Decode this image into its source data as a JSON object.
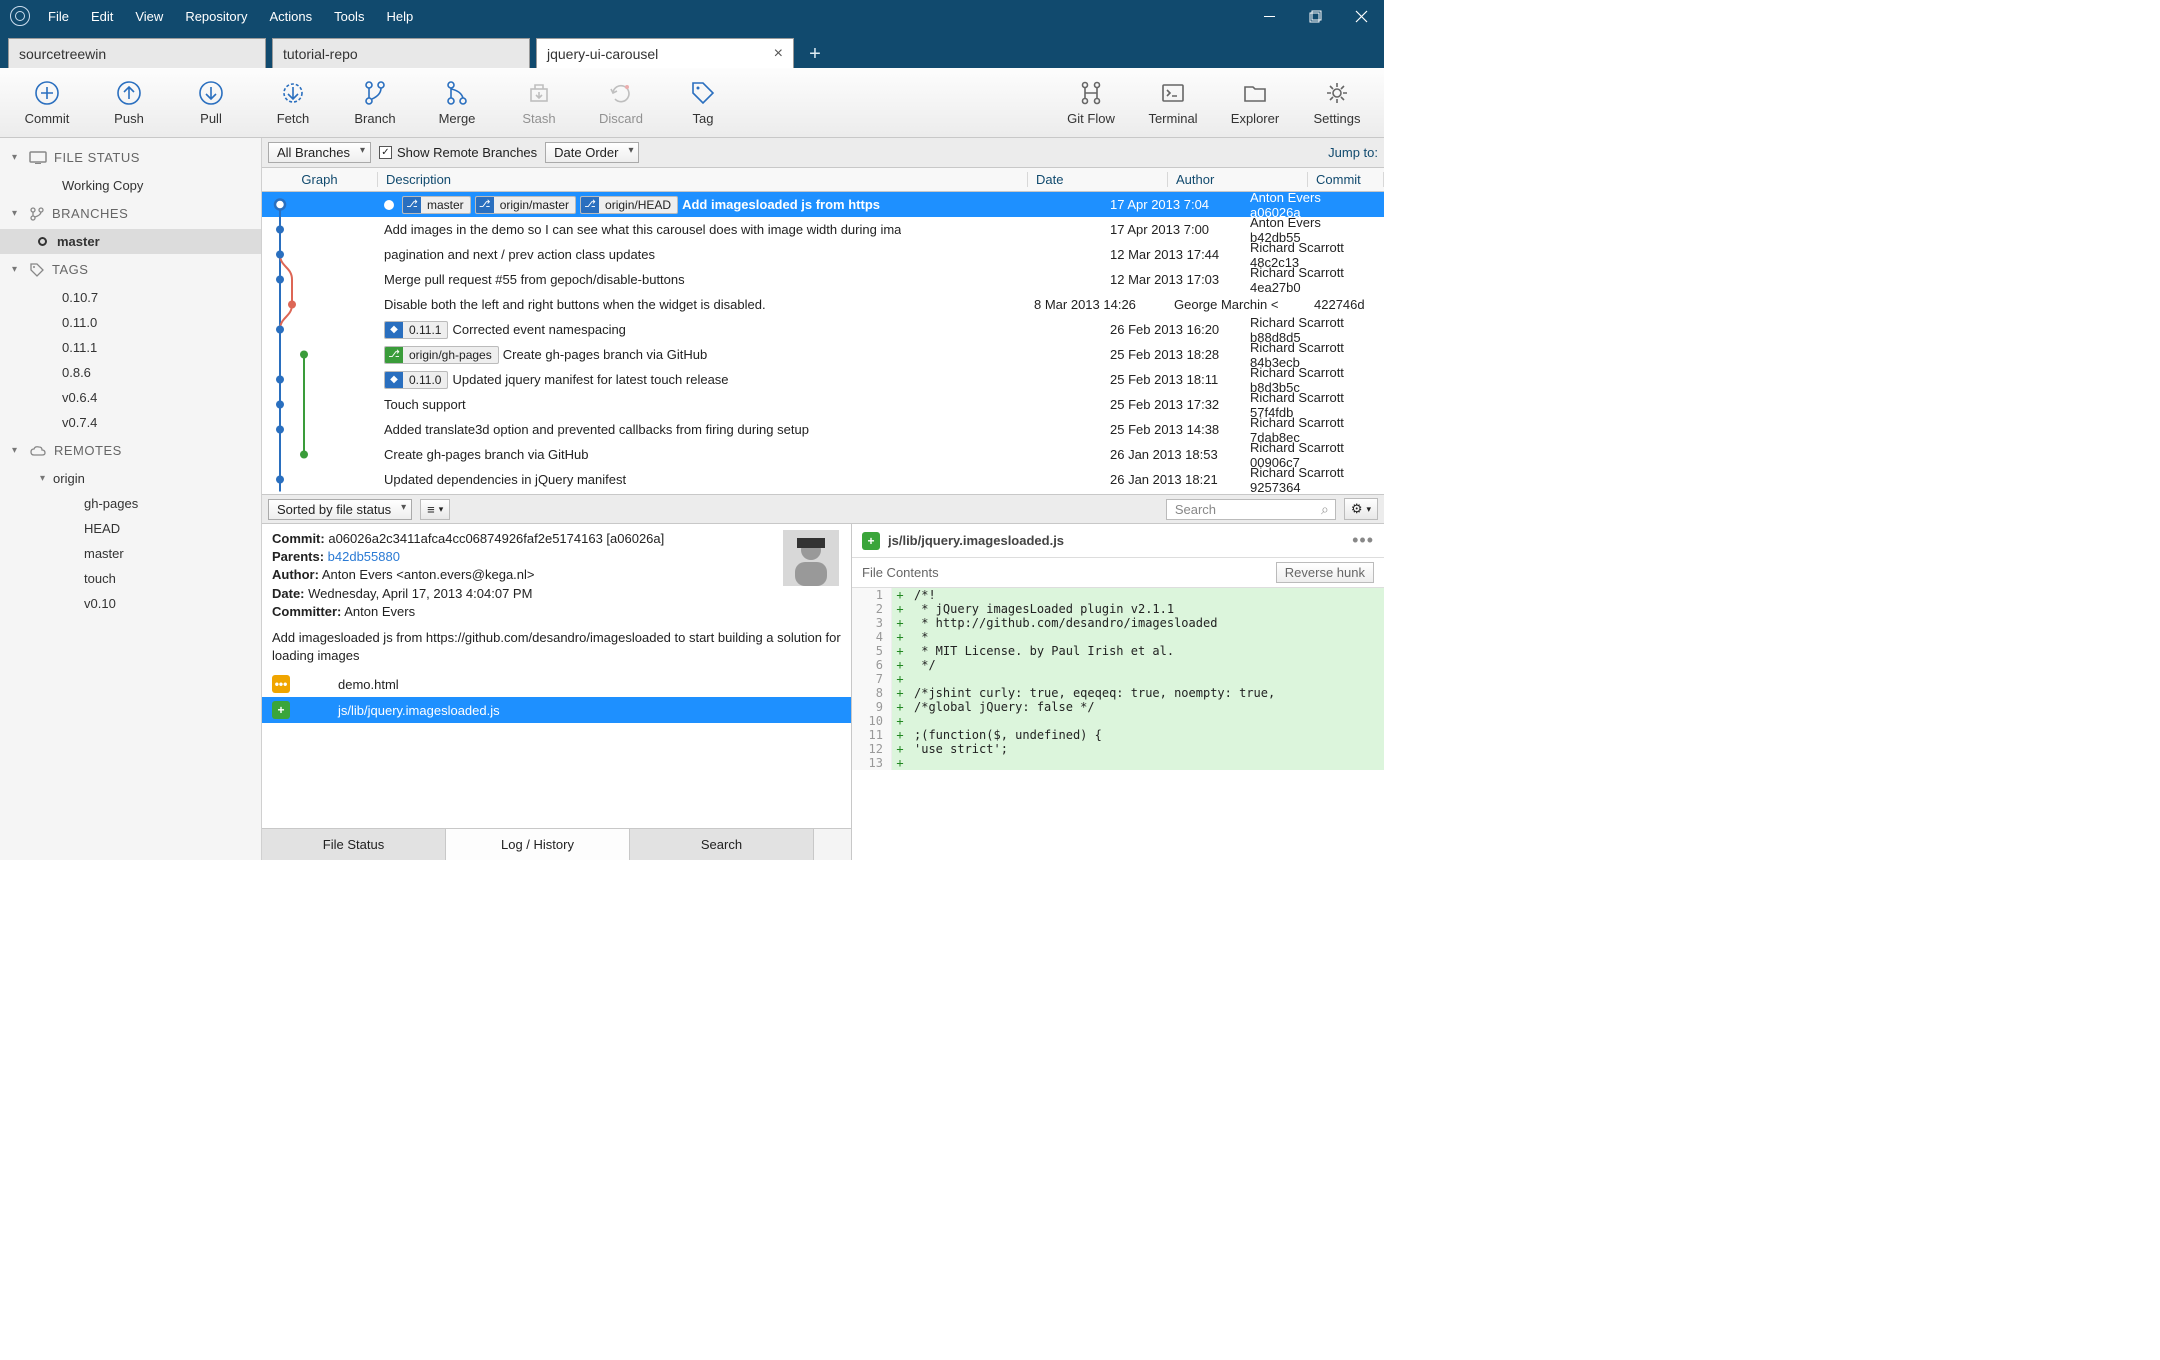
{
  "menu": [
    "File",
    "Edit",
    "View",
    "Repository",
    "Actions",
    "Tools",
    "Help"
  ],
  "tabs": [
    {
      "label": "sourcetreewin",
      "active": false
    },
    {
      "label": "tutorial-repo",
      "active": false
    },
    {
      "label": "jquery-ui-carousel",
      "active": true
    }
  ],
  "toolbar_left": [
    {
      "id": "commit",
      "label": "Commit"
    },
    {
      "id": "push",
      "label": "Push"
    },
    {
      "id": "pull",
      "label": "Pull"
    },
    {
      "id": "fetch",
      "label": "Fetch"
    },
    {
      "id": "branch",
      "label": "Branch"
    },
    {
      "id": "merge",
      "label": "Merge"
    },
    {
      "id": "stash",
      "label": "Stash",
      "disabled": true
    },
    {
      "id": "discard",
      "label": "Discard",
      "disabled": true
    },
    {
      "id": "tag",
      "label": "Tag"
    }
  ],
  "toolbar_right": [
    {
      "id": "gitflow",
      "label": "Git Flow"
    },
    {
      "id": "terminal",
      "label": "Terminal"
    },
    {
      "id": "explorer",
      "label": "Explorer"
    },
    {
      "id": "settings",
      "label": "Settings"
    }
  ],
  "sidebar": {
    "filestatus": {
      "title": "FILE STATUS",
      "items": [
        "Working Copy"
      ]
    },
    "branches": {
      "title": "BRANCHES",
      "items": [
        "master"
      ],
      "selected": "master"
    },
    "tags": {
      "title": "TAGS",
      "items": [
        "0.10.7",
        "0.11.0",
        "0.11.1",
        "0.8.6",
        "v0.6.4",
        "v0.7.4"
      ]
    },
    "remotes": {
      "title": "REMOTES",
      "origin_label": "origin",
      "items": [
        "gh-pages",
        "HEAD",
        "master",
        "touch",
        "v0.10"
      ]
    }
  },
  "filter": {
    "branches": "All Branches",
    "show_remote": "Show Remote Branches",
    "order": "Date Order",
    "jump": "Jump to:"
  },
  "columns": {
    "graph": "Graph",
    "desc": "Description",
    "date": "Date",
    "author": "Author",
    "commit": "Commit"
  },
  "commits": [
    {
      "refs": [
        {
          "t": "b",
          "n": "master"
        },
        {
          "t": "b",
          "n": "origin/master"
        },
        {
          "t": "b",
          "n": "origin/HEAD"
        }
      ],
      "tip": true,
      "msg": "Add imagesloaded js from https",
      "date": "17 Apr 2013 7:04",
      "author": "Anton Evers <anto",
      "hash": "a06026a",
      "sel": true
    },
    {
      "msg": "Add images in the demo so I can see what this carousel does with image width during ima",
      "date": "17 Apr 2013 7:00",
      "author": "Anton Evers <anto",
      "hash": "b42db55"
    },
    {
      "msg": "pagination and next / prev action class updates",
      "date": "12 Mar 2013 17:44",
      "author": "Richard Scarrott <r",
      "hash": "48c2c13"
    },
    {
      "msg": "Merge pull request #55 from gepoch/disable-buttons",
      "date": "12 Mar 2013 17:03",
      "author": "Richard Scarrott <r",
      "hash": "4ea27b0"
    },
    {
      "msg": "Disable both the left and right buttons when the widget is disabled.",
      "date": "8 Mar 2013 14:26",
      "author": "George Marchin <",
      "hash": "422746d"
    },
    {
      "refs": [
        {
          "t": "t",
          "n": "0.11.1"
        }
      ],
      "msg": "Corrected event namespacing",
      "date": "26 Feb 2013 16:20",
      "author": "Richard Scarrott <r",
      "hash": "b88d8d5"
    },
    {
      "refs": [
        {
          "t": "g",
          "n": "origin/gh-pages"
        }
      ],
      "msg": "Create gh-pages branch via GitHub",
      "date": "25 Feb 2013 18:28",
      "author": "Richard Scarrott <r",
      "hash": "84b3ecb"
    },
    {
      "refs": [
        {
          "t": "t",
          "n": "0.11.0"
        }
      ],
      "msg": "Updated jquery manifest for latest touch release",
      "date": "25 Feb 2013 18:11",
      "author": "Richard Scarrott <r",
      "hash": "b8d3b5c"
    },
    {
      "msg": "Touch support",
      "date": "25 Feb 2013 17:32",
      "author": "Richard Scarrott <r",
      "hash": "57f4fdb"
    },
    {
      "msg": "Added translate3d option and prevented callbacks from firing during setup",
      "date": "25 Feb 2013 14:38",
      "author": "Richard Scarrott <r",
      "hash": "7dab8ec"
    },
    {
      "msg": "Create gh-pages branch via GitHub",
      "date": "26 Jan 2013 18:53",
      "author": "Richard Scarrott <r",
      "hash": "00906c7"
    },
    {
      "msg": "Updated dependencies in jQuery manifest",
      "date": "26 Jan 2013 18:21",
      "author": "Richard Scarrott <r",
      "hash": "9257364"
    }
  ],
  "mid": {
    "sort": "Sorted by file status",
    "search_ph": "Search"
  },
  "commit_meta": {
    "commit_lbl": "Commit:",
    "commit": "a06026a2c3411afca4cc06874926faf2e5174163 [a06026a]",
    "parents_lbl": "Parents:",
    "parents": "b42db55880",
    "author_lbl": "Author:",
    "author": "Anton Evers <anton.evers@kega.nl>",
    "date_lbl": "Date:",
    "date": "Wednesday, April 17, 2013 4:04:07 PM",
    "committer_lbl": "Committer:",
    "committer": "Anton Evers",
    "message": "Add imagesloaded js from https://github.com/desandro/imagesloaded to start building a solution for loading images"
  },
  "files": [
    {
      "badge": "mod",
      "glyph": "•••",
      "name": "demo.html"
    },
    {
      "badge": "add",
      "glyph": "+",
      "name": "js/lib/jquery.imagesloaded.js",
      "sel": true
    }
  ],
  "diff_file": "js/lib/jquery.imagesloaded.js",
  "file_contents_lbl": "File Contents",
  "reverse_hunk": "Reverse hunk",
  "diff": [
    "/*!",
    " * jQuery imagesLoaded plugin v2.1.1",
    " * http://github.com/desandro/imagesloaded",
    " *",
    " * MIT License. by Paul Irish et al.",
    " */",
    "",
    "/*jshint curly: true, eqeqeq: true, noempty: true,",
    "/*global jQuery: false */",
    "",
    ";(function($, undefined) {",
    "'use strict';",
    ""
  ],
  "bottom_tabs": [
    "File Status",
    "Log / History",
    "Search"
  ]
}
